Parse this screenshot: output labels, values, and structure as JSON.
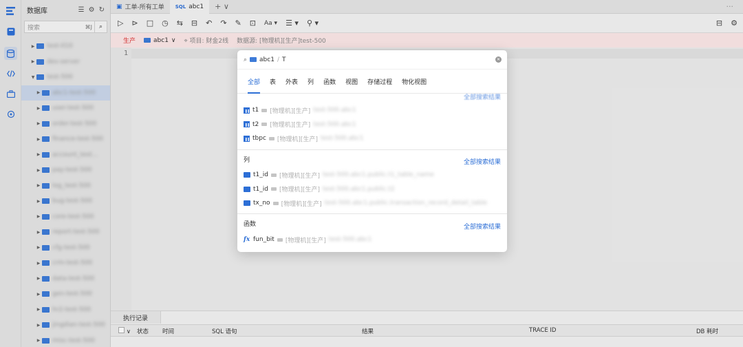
{
  "sidebar": {
    "title": "数据库",
    "search_placeholder": "搜索",
    "search_shortcut": "⌘J",
    "tree": [
      {
        "label": "test-010",
        "indent": 1,
        "expanded": false
      },
      {
        "label": "dev-server",
        "indent": 1,
        "expanded": false
      },
      {
        "label": "test-500",
        "indent": 1,
        "expanded": true
      },
      {
        "label": "abc1-test-500",
        "indent": 2,
        "selected": true
      },
      {
        "label": "user-test-500",
        "indent": 2
      },
      {
        "label": "order-test-500",
        "indent": 2
      },
      {
        "label": "finance-test-500",
        "indent": 2
      },
      {
        "label": "account_test...",
        "indent": 2
      },
      {
        "label": "pay-test-500",
        "indent": 2
      },
      {
        "label": "log_test-500",
        "indent": 2
      },
      {
        "label": "bug-test-500",
        "indent": 2
      },
      {
        "label": "core-test-500",
        "indent": 2
      },
      {
        "label": "report-test-500",
        "indent": 2
      },
      {
        "label": "cfg-test-500",
        "indent": 2
      },
      {
        "label": "crm-test-500",
        "indent": 2
      },
      {
        "label": "data-test-500",
        "indent": 2
      },
      {
        "label": "gen-test-500",
        "indent": 2
      },
      {
        "label": "hr2-test-500",
        "indent": 2
      },
      {
        "label": "jingdian-test-500",
        "indent": 2
      },
      {
        "label": "misc-test-500",
        "indent": 2
      }
    ]
  },
  "tabs": [
    {
      "label": "工单-所有工单",
      "active": false
    },
    {
      "label": "abc1",
      "prefix": "SQL",
      "active": true
    }
  ],
  "envbar": {
    "env": "生产",
    "db": "abc1",
    "project_label": "项目:",
    "project": "财金2线",
    "source_label": "数据源:",
    "source": "[物理机][生产]test-500"
  },
  "editor": {
    "line": "1"
  },
  "results": {
    "tab": "执行记录",
    "columns": [
      "状态",
      "时间",
      "SQL 语句",
      "结果",
      "TRACE ID",
      "DB 耗时"
    ]
  },
  "modal": {
    "db": "abc1",
    "query": "T",
    "tabs": [
      "全部",
      "表",
      "外表",
      "列",
      "函数",
      "视图",
      "存储过程",
      "物化视图"
    ],
    "active_tab": "全部",
    "tables": [
      {
        "name": "t1",
        "path": "[物理机][生产]",
        "blur": "test-500.abc1"
      },
      {
        "name": "t2",
        "path": "[物理机][生产]",
        "blur": "test-500.abc1"
      },
      {
        "name": "tbpc",
        "path": "[物理机][生产]",
        "blur": "test-500.abc1"
      }
    ],
    "columns_title": "列",
    "columns": [
      {
        "name": "t1_id",
        "path": "[物理机][生产]",
        "blur": "test-500.abc1.public.t1_table_name"
      },
      {
        "name": "t1_id",
        "path": "[物理机][生产]",
        "blur": "test-500.abc1.public.t2"
      },
      {
        "name": "tx_no",
        "path": "[物理机][生产]",
        "blur": "test-500.abc1.public.transaction_record_detail_table"
      }
    ],
    "functions_title": "函数",
    "functions": [
      {
        "name": "fun_bit",
        "path": "[物理机][生产]",
        "blur": "test-500.abc1"
      }
    ],
    "all_results_link": "全部搜索结果"
  }
}
